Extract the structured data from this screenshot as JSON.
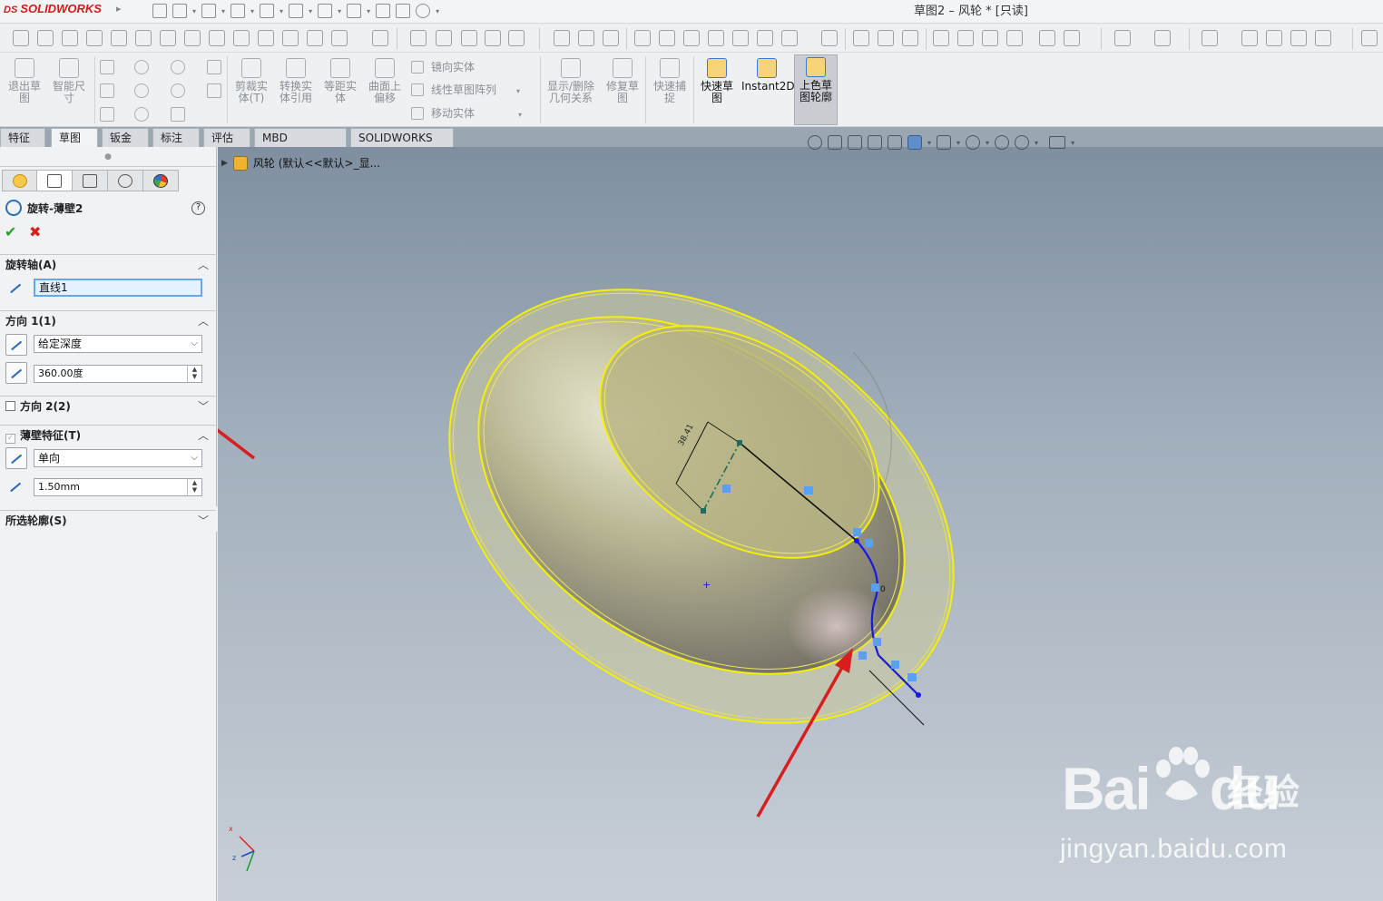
{
  "app": {
    "logo": "SOLIDWORKS",
    "window_title": "草图2 – 风轮 * [只读]"
  },
  "ribbon": {
    "exit_sketch": "退出草图",
    "smart_dim": "智能尺寸",
    "trim": "剪裁实体(T)",
    "convert": "转换实体引用",
    "offset": "等距实体",
    "surface_offset": "曲面上偏移",
    "mirror": "镜向实体",
    "linear_pattern": "线性草图阵列",
    "move": "移动实体",
    "show_relations": "显示/删除几何关系",
    "repair": "修复草图",
    "quick_snap": "快速捕捉",
    "rapid_sketch": "快速草图",
    "instant2d": "Instant2D",
    "shaded_sketch": "上色草图轮廓"
  },
  "tabs": [
    "特征",
    "草图",
    "钣金",
    "标注",
    "评估",
    "MBD Dimensions",
    "SOLIDWORKS 插件"
  ],
  "active_tab": 1,
  "tree": {
    "root": "风轮 (默认<<默认>_显..."
  },
  "property_manager": {
    "title": "旋转-薄壁2",
    "help": "?",
    "axis_section": "旋转轴(A)",
    "axis_value": "直线1",
    "dir1_section": "方向 1(1)",
    "dir1_type": "给定深度",
    "dir1_angle": "360.00度",
    "dir2_section": "方向 2(2)",
    "thin_section": "薄壁特征(T)",
    "thin_type": "单向",
    "thin_thickness": "1.50mm",
    "contours_section": "所选轮廓(S)"
  },
  "viewport": {
    "dimension_label": "38.41",
    "point_label": "0",
    "triad_x": "x",
    "triad_z": "z",
    "highlight_color": "#f5f000",
    "sketch_color": "#1a1adf",
    "arrow_color": "#d81e1e"
  },
  "watermark": {
    "logo": "Bai",
    "logo2": "du",
    "chinese": "经验",
    "url": "jingyan.baidu.com"
  }
}
